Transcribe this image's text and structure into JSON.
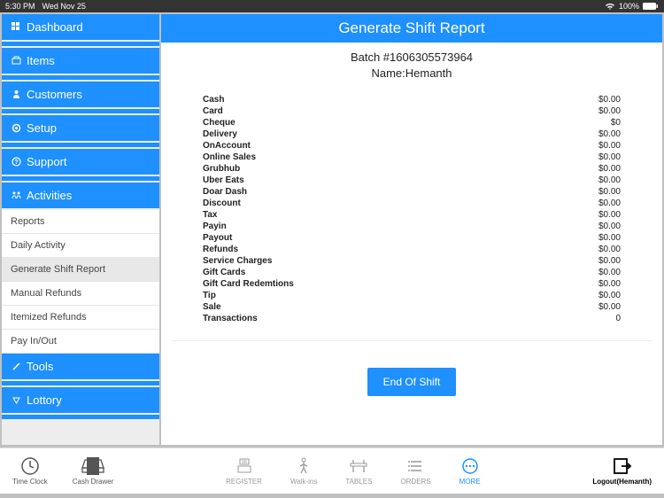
{
  "status": {
    "time": "5:30 PM",
    "date": "Wed Nov 25",
    "wifi": "wifi-icon",
    "battery": "100%"
  },
  "sidebar": {
    "dashboard": "Dashboard",
    "items": "Items",
    "customers": "Customers",
    "setup": "Setup",
    "support": "Support",
    "activities": "Activities",
    "tools": "Tools",
    "lottory": "Lottory",
    "subs": {
      "reports": "Reports",
      "daily": "Daily Activity",
      "shift": "Generate Shift Report",
      "manual_refunds": "Manual Refunds",
      "itemized_refunds": "Itemized Refunds",
      "payinout": "Pay In/Out"
    }
  },
  "content": {
    "title": "Generate Shift Report",
    "batch": "Batch #1606305573964",
    "name": "Name:Hemanth",
    "rows": [
      {
        "label": "Cash",
        "value": "$0.00"
      },
      {
        "label": "Card",
        "value": "$0.00"
      },
      {
        "label": "Cheque",
        "value": "$0"
      },
      {
        "label": "Delivery",
        "value": "$0.00"
      },
      {
        "label": "OnAccount",
        "value": "$0.00"
      },
      {
        "label": "Online Sales",
        "value": "$0.00"
      },
      {
        "label": "Grubhub",
        "value": "$0.00"
      },
      {
        "label": "Uber Eats",
        "value": "$0.00"
      },
      {
        "label": "Doar Dash",
        "value": "$0.00"
      },
      {
        "label": "Discount",
        "value": "$0.00"
      },
      {
        "label": "Tax",
        "value": "$0.00"
      },
      {
        "label": "Payin",
        "value": "$0.00"
      },
      {
        "label": "Payout",
        "value": "$0.00"
      },
      {
        "label": "Refunds",
        "value": "$0.00"
      },
      {
        "label": "Service Charges",
        "value": "$0.00"
      },
      {
        "label": "Gift Cards",
        "value": "$0.00"
      },
      {
        "label": "Gift Card Redemtions",
        "value": "$0.00"
      },
      {
        "label": "Tip",
        "value": "$0.00"
      },
      {
        "label": "Sale",
        "value": "$0.00"
      },
      {
        "label": "Transactions",
        "value": "0"
      }
    ],
    "end_shift": "End Of Shift"
  },
  "bottom": {
    "time_clock": "Time Clock",
    "cash_drawer": "Cash Drawer",
    "register": "REGISTER",
    "walkins": "Walk-ins",
    "tables": "TABLES",
    "orders": "ORDERS",
    "more": "MORE",
    "logout": "Logout(Hemanth)"
  }
}
